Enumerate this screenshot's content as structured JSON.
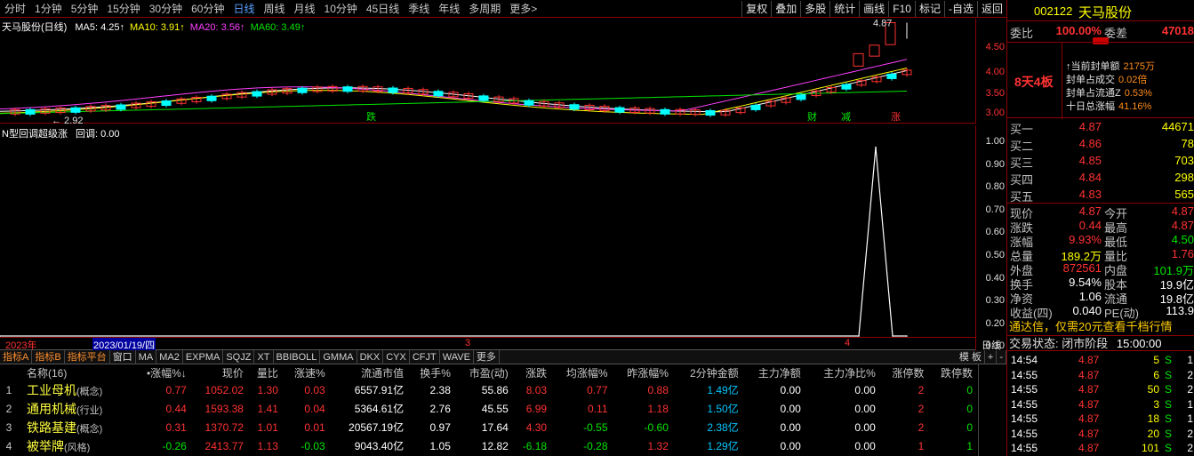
{
  "toolbar": {
    "periods": [
      "分时",
      "1分钟",
      "5分钟",
      "15分钟",
      "30分钟",
      "60分钟",
      "日线",
      "周线",
      "月线",
      "10分钟",
      "45日线",
      "季线",
      "年线",
      "多周期",
      "更多>"
    ],
    "active_period": "日线",
    "tools": [
      "复权",
      "叠加",
      "多股",
      "统计",
      "画线",
      "F10",
      "标记",
      "-自选",
      "返回"
    ]
  },
  "main_chart": {
    "title": "天马股份(日线)",
    "ma": [
      {
        "label": "MA5: 4.25",
        "color": "#ffffff"
      },
      {
        "label": "MA10: 3.91",
        "color": "#ffff00"
      },
      {
        "label": "MA20: 3.56",
        "color": "#ff40ff"
      },
      {
        "label": "MA60: 3.49",
        "color": "#00e600"
      }
    ],
    "yticks": [
      "4.50",
      "4.00",
      "3.50",
      "3.00"
    ],
    "high_label": "4.87",
    "low_label": "2.92",
    "markers": [
      {
        "text": "跌",
        "color": "#00e600"
      },
      {
        "text": "财",
        "color": "#00e600"
      },
      {
        "text": "减",
        "color": "#00e600"
      },
      {
        "text": "涨",
        "color": "#ff3232"
      }
    ]
  },
  "indicator": {
    "title": "N型回调超级涨",
    "value_label": "回调: 0.00",
    "yticks": [
      "1.00",
      "0.90",
      "0.80",
      "0.70",
      "0.60",
      "0.50",
      "0.40",
      "0.30",
      "0.20",
      "0.10"
    ]
  },
  "chart_data": {
    "type": "line",
    "title": "N型回调超级涨",
    "series": [
      {
        "name": "回调",
        "values": [
          0,
          0,
          1,
          0,
          0
        ]
      }
    ],
    "ylim": [
      0,
      1.05
    ]
  },
  "date_axis": {
    "labels": [
      "2023年",
      "2023/01/19/四",
      "3",
      "4"
    ],
    "freq": "日线"
  },
  "indicator_tabs": {
    "items": [
      "指标A",
      "指标B",
      "指标平台",
      "窗口",
      "MA",
      "MA2",
      "EXPMA",
      "SQJZ",
      "XT",
      "BBIBOLL",
      "GMMA",
      "DKX",
      "CYX",
      "CFJT",
      "WAVE",
      "更多"
    ],
    "active": "指标平台",
    "right": [
      "模 板",
      "+",
      "-"
    ]
  },
  "board": {
    "headers": [
      "名称(16)",
      "•涨幅%↓",
      "现价",
      "量比",
      "涨速%",
      "流通市值",
      "换手%",
      "市盈(动)",
      "涨跌",
      "均涨幅%",
      "昨涨幅%",
      "2分钟金额",
      "主力净额",
      "主力净比%",
      "涨停数",
      "跌停数"
    ],
    "rows": [
      {
        "idx": "1",
        "name": "工业母机",
        "tag": "(概念)",
        "cells": [
          "0.77",
          "1052.02",
          "1.30",
          "0.03",
          "6557.91亿",
          "2.38",
          "55.86",
          "8.03",
          "0.77",
          "0.88",
          "1.49亿",
          "0.00",
          "0.00",
          "2",
          "0"
        ]
      },
      {
        "idx": "2",
        "name": "通用机械",
        "tag": "(行业)",
        "cells": [
          "0.44",
          "1593.38",
          "1.41",
          "0.04",
          "5364.61亿",
          "2.76",
          "45.55",
          "6.99",
          "0.11",
          "1.18",
          "1.50亿",
          "0.00",
          "0.00",
          "2",
          "0"
        ]
      },
      {
        "idx": "3",
        "name": "铁路基建",
        "tag": "(概念)",
        "cells": [
          "0.31",
          "1370.72",
          "1.01",
          "0.01",
          "20567.19亿",
          "0.97",
          "17.64",
          "4.30",
          "-0.55",
          "-0.60",
          "2.38亿",
          "0.00",
          "0.00",
          "2",
          "0"
        ]
      },
      {
        "idx": "4",
        "name": "被举牌",
        "tag": "(风格)",
        "cells": [
          "-0.26",
          "2413.77",
          "1.13",
          "-0.03",
          "9043.40亿",
          "1.05",
          "12.82",
          "-6.18",
          "-0.28",
          "1.32",
          "1.29亿",
          "0.00",
          "0.00",
          "1",
          "1"
        ]
      }
    ]
  },
  "quote": {
    "code": "002122",
    "name": "天马股份",
    "weibi_label": "委比",
    "weibi": "100.00%",
    "weicha_label": "委差",
    "weicha": "47018",
    "days_boards": "8天4板",
    "seal": [
      {
        "k": "↑当前封单额",
        "v": "2175万"
      },
      {
        "k": "封单占成交",
        "v": "0.02倍"
      },
      {
        "k": "封单占流通Z",
        "v": "0.53%"
      },
      {
        "k": "十日总涨幅",
        "v": "41.16%"
      }
    ],
    "bids": [
      {
        "l": "买一",
        "p": "4.87",
        "v": "44671"
      },
      {
        "l": "买二",
        "p": "4.86",
        "v": "78"
      },
      {
        "l": "买三",
        "p": "4.85",
        "v": "703"
      },
      {
        "l": "买四",
        "p": "4.84",
        "v": "298"
      },
      {
        "l": "买五",
        "p": "4.83",
        "v": "565"
      }
    ],
    "stats": [
      {
        "l": "现价",
        "v": "4.87",
        "l2": "今开",
        "v2": "4.87"
      },
      {
        "l": "涨跌",
        "v": "0.44",
        "l2": "最高",
        "v2": "4.87"
      },
      {
        "l": "涨幅",
        "v": "9.93%",
        "l2": "最低",
        "v2": "4.50"
      },
      {
        "l": "总量",
        "v": "189.2万",
        "l2": "量比",
        "v2": "1.76"
      },
      {
        "l": "外盘",
        "v": "872561",
        "l2": "内盘",
        "v2": "101.9万"
      },
      {
        "l": "换手",
        "v": "9.54%",
        "l2": "股本",
        "v2": "19.9亿"
      },
      {
        "l": "净资",
        "v": "1.06",
        "l2": "流通",
        "v2": "19.8亿"
      },
      {
        "l": "收益(四)",
        "v": "0.040",
        "l2": "PE(动)",
        "v2": "113.9"
      }
    ],
    "banner": "通达信，仅需20元查看千档行情",
    "trade_state_label": "交易状态:",
    "trade_state": "闭市阶段",
    "trade_time": "15:00:00",
    "ticks": [
      {
        "t": "14:54",
        "p": "4.87",
        "v": "5",
        "s": "S",
        "n": "1"
      },
      {
        "t": "14:55",
        "p": "4.87",
        "v": "6",
        "s": "S",
        "n": "2"
      },
      {
        "t": "14:55",
        "p": "4.87",
        "v": "50",
        "s": "S",
        "n": "2"
      },
      {
        "t": "14:55",
        "p": "4.87",
        "v": "3",
        "s": "S",
        "n": "1"
      },
      {
        "t": "14:55",
        "p": "4.87",
        "v": "18",
        "s": "S",
        "n": "1"
      },
      {
        "t": "14:55",
        "p": "4.87",
        "v": "20",
        "s": "S",
        "n": "2"
      },
      {
        "t": "14:55",
        "p": "4.87",
        "v": "101",
        "s": "S",
        "n": "2"
      }
    ]
  }
}
